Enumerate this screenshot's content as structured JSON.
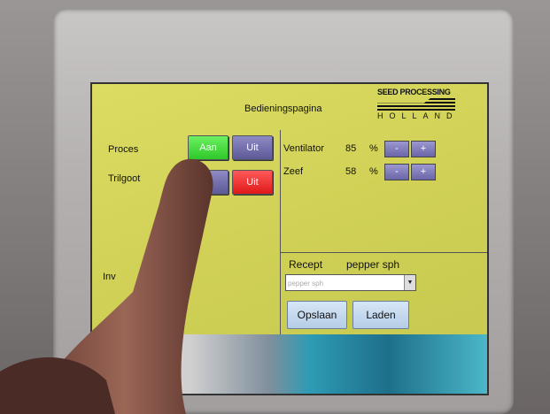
{
  "page": {
    "title": "Bedieningspagina"
  },
  "logo": {
    "line1": "SEED PROCESSING",
    "line2": "HOLLAND"
  },
  "controls": {
    "proces": {
      "label": "Proces",
      "on_label": "Aan",
      "off_label": "Uit"
    },
    "trilgoot": {
      "label": "Trilgoot",
      "on_label": "",
      "off_label": "Uit"
    },
    "inv_label": "Inv"
  },
  "settings": {
    "ventilator": {
      "label": "Ventilator",
      "value": "85",
      "unit": "%",
      "minus": "-",
      "plus": "+"
    },
    "zeef": {
      "label": "Zeef",
      "value": "58",
      "unit": "%",
      "minus": "-",
      "plus": "+"
    }
  },
  "recipe": {
    "label": "Recept",
    "current": "pepper sph",
    "select_value": "pepper sph",
    "save_label": "Opslaan",
    "load_label": "Laden"
  },
  "colors": {
    "screen_bg": "#d8d85a",
    "on_green": "#2ec82a",
    "off_red": "#e01818",
    "neutral_purple": "#5d5998"
  },
  "icons": {
    "dropdown": "chevron-down-icon"
  }
}
